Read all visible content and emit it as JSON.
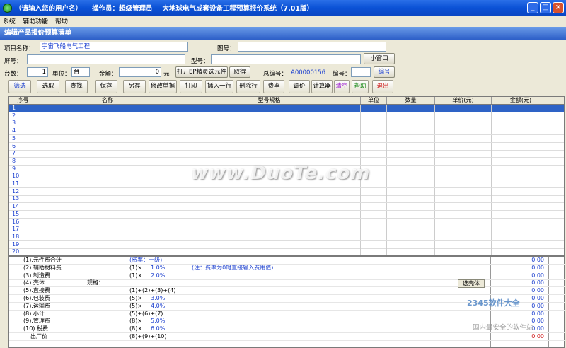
{
  "titlebar": {
    "user": "（请输入您的用户名）",
    "operator": "操作员：超级管理员",
    "title": "大地球电气成套设备工程预算报价系统（7.01版）"
  },
  "menu": [
    "系统",
    "辅助功能",
    "帮助"
  ],
  "panel_title": "编辑产品报价预算清单",
  "form": {
    "project_label": "项目名称：",
    "project_value": "宇宙飞船电气工程",
    "drawing_label": "图号：",
    "drawing_value": "",
    "screen_label": "屏号：",
    "screen_value": "",
    "model_label": "型号：",
    "model_value": "",
    "small_window": "小窗口",
    "count_label": "台数：",
    "count_value": "1",
    "unit_label": "单位：",
    "unit_value": "台",
    "amount_label": "金额：",
    "amount_value": "0",
    "amount_unit": "元",
    "open_ep": "打开EP精灵选元件",
    "fetch": "取得",
    "total_no_label": "总编号：",
    "total_no_value": "A00000156",
    "number_label": "编号：",
    "number_value": "",
    "number_btn": "编号"
  },
  "toolbar": [
    "筛选",
    "选取",
    "查找",
    "保存",
    "另存",
    "修改单据",
    "打印",
    "插入一行",
    "删除行",
    "费率",
    "调价",
    "计算器",
    "清空",
    "帮助",
    "退出"
  ],
  "grid": {
    "headers": [
      "序号",
      "名称",
      "型号规格",
      "单位",
      "数量",
      "单价(元)",
      "金额(元)"
    ],
    "rows": [
      "1",
      "2",
      "3",
      "4",
      "5",
      "6",
      "7",
      "8",
      "9",
      "10",
      "11",
      "12",
      "13",
      "14",
      "15",
      "16",
      "17",
      "18",
      "19",
      "20"
    ]
  },
  "summary": [
    {
      "label": "(1).元件费合计",
      "formula": "(费率：一级)",
      "pct": "",
      "note": "",
      "value": "0.00"
    },
    {
      "label": "(2).辅助材料费",
      "formula": "(1)×",
      "pct": "1.0%",
      "note": "(注：费率为0时直接输入费用值)",
      "value": "0.00"
    },
    {
      "label": "(3).制造费",
      "formula": "(1)×",
      "pct": "2.0%",
      "note": "",
      "value": "0.00"
    },
    {
      "label": "(4).壳体",
      "formula": "规格：",
      "pct": "",
      "note": "选壳体",
      "value": "0.00"
    },
    {
      "label": "(5).直接费",
      "formula": "(1)+(2)+(3)+(4)",
      "pct": "",
      "note": "",
      "value": "0.00"
    },
    {
      "label": "(6).包装费",
      "formula": "(5)×",
      "pct": "3.0%",
      "note": "",
      "value": "0.00"
    },
    {
      "label": "(7).运输费",
      "formula": "(5)×",
      "pct": "4.0%",
      "note": "",
      "value": "0.00"
    },
    {
      "label": "(8).小计",
      "formula": "(5)+(6)+(7)",
      "pct": "",
      "note": "",
      "value": "0.00"
    },
    {
      "label": "(9).管理费",
      "formula": "(8)×",
      "pct": "5.0%",
      "note": "",
      "value": "0.00"
    },
    {
      "label": "(10).税费",
      "formula": "(8)×",
      "pct": "6.0%",
      "note": "",
      "value": "0.00"
    },
    {
      "label": "出厂价",
      "formula": "(8)+(9)+(10)",
      "pct": "",
      "note": "",
      "value": "0.00"
    }
  ],
  "watermarks": [
    "www.DuoTe.com",
    "2345软件大全",
    "国内最安全的软件站"
  ]
}
